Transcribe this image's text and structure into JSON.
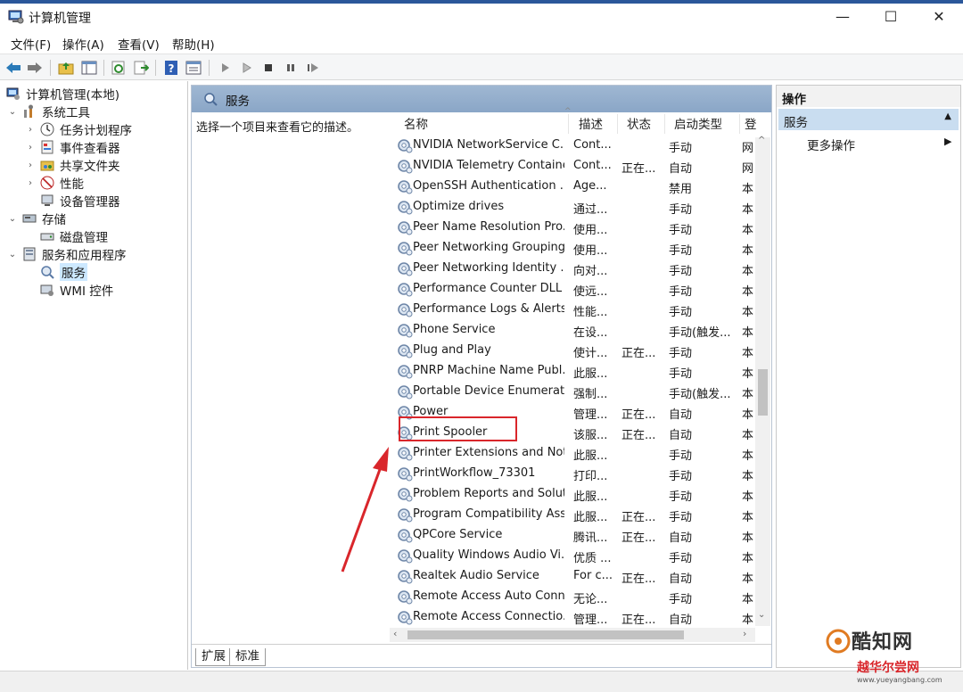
{
  "window": {
    "title": "计算机管理",
    "min_glyph": "—",
    "max_glyph": "☐",
    "close_glyph": "✕"
  },
  "menu": [
    {
      "label": "文件(F)"
    },
    {
      "label": "操作(A)"
    },
    {
      "label": "查看(V)"
    },
    {
      "label": "帮助(H)"
    }
  ],
  "toolbar": {
    "icons": [
      "back-arrow-icon",
      "forward-arrow-icon",
      "up-folder-icon",
      "show-hide-tree-icon",
      "refresh-icon",
      "export-list-icon",
      "help-icon",
      "properties-icon",
      "start-icon",
      "start-outline-icon",
      "stop-icon",
      "pause-icon",
      "restart-icon"
    ]
  },
  "tree": {
    "root": "计算机管理(本地)",
    "system_tools": "系统工具",
    "task_scheduler": "任务计划程序",
    "event_viewer": "事件查看器",
    "shared_folders": "共享文件夹",
    "performance": "性能",
    "device_manager": "设备管理器",
    "storage": "存储",
    "disk_management": "磁盘管理",
    "services_apps": "服务和应用程序",
    "services": "服务",
    "wmi": "WMI 控件"
  },
  "center": {
    "title": "服务",
    "description_prompt": "选择一个项目来查看它的描述。",
    "columns": {
      "name": "名称",
      "desc": "描述",
      "status": "状态",
      "startup": "启动类型",
      "logon": "登"
    },
    "rows": [
      {
        "name": "NVIDIA NetworkService C...",
        "desc": "Cont...",
        "status": "",
        "startup": "手动",
        "logon": "网"
      },
      {
        "name": "NVIDIA Telemetry Container",
        "desc": "Cont...",
        "status": "正在...",
        "startup": "自动",
        "logon": "网"
      },
      {
        "name": "OpenSSH Authentication ...",
        "desc": "Age...",
        "status": "",
        "startup": "禁用",
        "logon": "本"
      },
      {
        "name": "Optimize drives",
        "desc": "通过...",
        "status": "",
        "startup": "手动",
        "logon": "本"
      },
      {
        "name": "Peer Name Resolution Pro...",
        "desc": "使用...",
        "status": "",
        "startup": "手动",
        "logon": "本"
      },
      {
        "name": "Peer Networking Grouping",
        "desc": "使用...",
        "status": "",
        "startup": "手动",
        "logon": "本"
      },
      {
        "name": "Peer Networking Identity ...",
        "desc": "向对...",
        "status": "",
        "startup": "手动",
        "logon": "本"
      },
      {
        "name": "Performance Counter DLL ...",
        "desc": "使远...",
        "status": "",
        "startup": "手动",
        "logon": "本"
      },
      {
        "name": "Performance Logs & Alerts",
        "desc": "性能...",
        "status": "",
        "startup": "手动",
        "logon": "本"
      },
      {
        "name": "Phone Service",
        "desc": "在设...",
        "status": "",
        "startup": "手动(触发...",
        "logon": "本"
      },
      {
        "name": "Plug and Play",
        "desc": "使计...",
        "status": "正在...",
        "startup": "手动",
        "logon": "本"
      },
      {
        "name": "PNRP Machine Name Publ...",
        "desc": "此服...",
        "status": "",
        "startup": "手动",
        "logon": "本"
      },
      {
        "name": "Portable Device Enumerat...",
        "desc": "强制...",
        "status": "",
        "startup": "手动(触发...",
        "logon": "本"
      },
      {
        "name": "Power",
        "desc": "管理...",
        "status": "正在...",
        "startup": "自动",
        "logon": "本"
      },
      {
        "name": "Print Spooler",
        "desc": "该服...",
        "status": "正在...",
        "startup": "自动",
        "logon": "本"
      },
      {
        "name": "Printer Extensions and Noti...",
        "desc": "此服...",
        "status": "",
        "startup": "手动",
        "logon": "本"
      },
      {
        "name": "PrintWorkflow_73301",
        "desc": "打印...",
        "status": "",
        "startup": "手动",
        "logon": "本"
      },
      {
        "name": "Problem Reports and Solut...",
        "desc": "此服...",
        "status": "",
        "startup": "手动",
        "logon": "本"
      },
      {
        "name": "Program Compatibility Assi...",
        "desc": "此服...",
        "status": "正在...",
        "startup": "手动",
        "logon": "本"
      },
      {
        "name": "QPCore Service",
        "desc": "腾讯...",
        "status": "正在...",
        "startup": "自动",
        "logon": "本"
      },
      {
        "name": "Quality Windows Audio Vi...",
        "desc": "优质 ...",
        "status": "",
        "startup": "手动",
        "logon": "本"
      },
      {
        "name": "Realtek Audio Service",
        "desc": "For c...",
        "status": "正在...",
        "startup": "自动",
        "logon": "本"
      },
      {
        "name": "Remote Access Auto Conn...",
        "desc": "无论...",
        "status": "",
        "startup": "手动",
        "logon": "本"
      },
      {
        "name": "Remote Access Connectio...",
        "desc": "管理...",
        "status": "正在...",
        "startup": "自动",
        "logon": "本"
      }
    ],
    "tabs": {
      "extended": "扩展",
      "standard": "标准"
    }
  },
  "actions": {
    "title": "操作",
    "section": "服务",
    "more": "更多操作"
  },
  "watermark": {
    "brand": "酷知网",
    "brand2": "越华尔尝网",
    "url": "www.yueyangbang.com"
  },
  "colors": {
    "header_blue": "#9fb7d2",
    "highlight_red": "#d9262b",
    "selection": "#cce8ff"
  }
}
